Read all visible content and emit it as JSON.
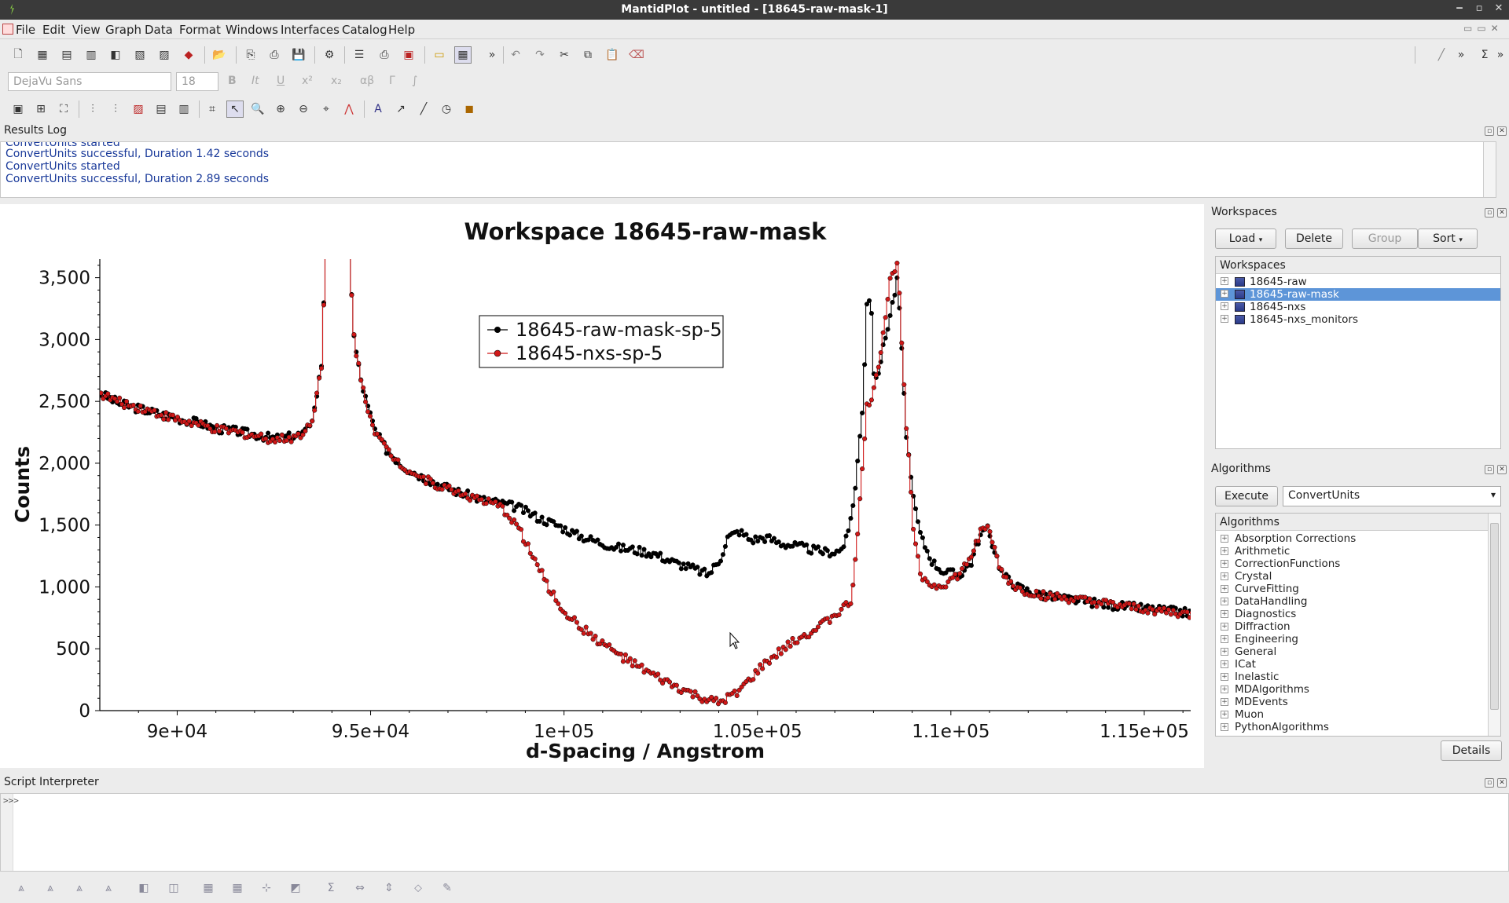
{
  "window": {
    "title": "MantidPlot - untitled - [18645-raw-mask-1]",
    "controls": [
      "‒",
      "▫",
      "✕"
    ]
  },
  "menu": [
    "File",
    "Edit",
    "View",
    "Graph",
    "Data",
    "Format",
    "Windows",
    "Interfaces",
    "Catalog",
    "Help"
  ],
  "format_bar": {
    "font": "DejaVu Sans",
    "size": "18",
    "bold": "B",
    "italic": "It",
    "underline": "U",
    "superscript": "x²",
    "subscript": "x₂",
    "greek": "αβ",
    "greek_upper": "Γ",
    "integral": "∫"
  },
  "results_log": {
    "title": "Results Log",
    "lines": [
      "ConvertUnits started",
      "ConvertUnits successful, Duration 1.42 seconds",
      "ConvertUnits started",
      "ConvertUnits successful, Duration 2.89 seconds"
    ]
  },
  "plot_tab": "1",
  "chart_data": {
    "type": "line",
    "title": "Workspace 18645-raw-mask",
    "xlabel": "d-Spacing / Angstrom",
    "ylabel": "Counts",
    "xlim": [
      88000,
      116200
    ],
    "ylim": [
      0,
      3650
    ],
    "x_ticks": [
      "9e+04",
      "9.5e+04",
      "1e+05",
      "1.05e+05",
      "1.1e+05",
      "1.15e+05"
    ],
    "x_tick_values": [
      90000,
      95000,
      100000,
      105000,
      110000,
      115000
    ],
    "y_ticks": [
      "0",
      "500",
      "1,000",
      "1,500",
      "2,000",
      "2,500",
      "3,000",
      "3,500"
    ],
    "y_tick_values": [
      0,
      500,
      1000,
      1500,
      2000,
      2500,
      3000,
      3500
    ],
    "legend_position": "top-center",
    "series": [
      {
        "name": "18645-raw-mask-sp-5",
        "color": "#000000",
        "points": [
          [
            88000,
            2560
          ],
          [
            88500,
            2480
          ],
          [
            89000,
            2440
          ],
          [
            89500,
            2400
          ],
          [
            90000,
            2360
          ],
          [
            90500,
            2330
          ],
          [
            91000,
            2280
          ],
          [
            91500,
            2260
          ],
          [
            92000,
            2230
          ],
          [
            92500,
            2200
          ],
          [
            93000,
            2220
          ],
          [
            93300,
            2250
          ],
          [
            93500,
            2400
          ],
          [
            93700,
            2800
          ],
          [
            93900,
            4500
          ],
          [
            94400,
            4500
          ],
          [
            94500,
            3100
          ],
          [
            94700,
            2700
          ],
          [
            94900,
            2450
          ],
          [
            95100,
            2250
          ],
          [
            95400,
            2100
          ],
          [
            95800,
            1980
          ],
          [
            96300,
            1890
          ],
          [
            96800,
            1820
          ],
          [
            97300,
            1760
          ],
          [
            97800,
            1710
          ],
          [
            98300,
            1680
          ],
          [
            98800,
            1640
          ],
          [
            99300,
            1560
          ],
          [
            99800,
            1500
          ],
          [
            100300,
            1420
          ],
          [
            100800,
            1370
          ],
          [
            101300,
            1320
          ],
          [
            101800,
            1300
          ],
          [
            102300,
            1270
          ],
          [
            102800,
            1200
          ],
          [
            103300,
            1150
          ],
          [
            103700,
            1100
          ],
          [
            104000,
            1220
          ],
          [
            104200,
            1400
          ],
          [
            104500,
            1450
          ],
          [
            104800,
            1380
          ],
          [
            105200,
            1400
          ],
          [
            105600,
            1350
          ],
          [
            106000,
            1330
          ],
          [
            106400,
            1300
          ],
          [
            106800,
            1280
          ],
          [
            107100,
            1290
          ],
          [
            107300,
            1400
          ],
          [
            107500,
            1800
          ],
          [
            107700,
            2500
          ],
          [
            107800,
            3300
          ],
          [
            107900,
            3360
          ],
          [
            108000,
            2600
          ],
          [
            108200,
            2900
          ],
          [
            108400,
            3200
          ],
          [
            108600,
            3500
          ],
          [
            108800,
            2300
          ],
          [
            109000,
            1700
          ],
          [
            109200,
            1400
          ],
          [
            109500,
            1200
          ],
          [
            109800,
            1120
          ],
          [
            110200,
            1100
          ],
          [
            110500,
            1200
          ],
          [
            110700,
            1400
          ],
          [
            110900,
            1480
          ],
          [
            111100,
            1300
          ],
          [
            111300,
            1100
          ],
          [
            111700,
            1000
          ],
          [
            112200,
            940
          ],
          [
            112800,
            910
          ],
          [
            113500,
            880
          ],
          [
            114200,
            850
          ],
          [
            114900,
            830
          ],
          [
            115500,
            810
          ],
          [
            116200,
            790
          ]
        ]
      },
      {
        "name": "18645-nxs-sp-5",
        "color": "#d01818",
        "points": [
          [
            88000,
            2560
          ],
          [
            88500,
            2490
          ],
          [
            89000,
            2450
          ],
          [
            89500,
            2400
          ],
          [
            90000,
            2350
          ],
          [
            90500,
            2310
          ],
          [
            91000,
            2270
          ],
          [
            91500,
            2250
          ],
          [
            92000,
            2220
          ],
          [
            92500,
            2190
          ],
          [
            93000,
            2210
          ],
          [
            93300,
            2260
          ],
          [
            93500,
            2400
          ],
          [
            93700,
            2800
          ],
          [
            93900,
            4500
          ],
          [
            94400,
            4500
          ],
          [
            94500,
            3100
          ],
          [
            94700,
            2700
          ],
          [
            94900,
            2450
          ],
          [
            95100,
            2250
          ],
          [
            95400,
            2100
          ],
          [
            95800,
            1980
          ],
          [
            96300,
            1880
          ],
          [
            96800,
            1810
          ],
          [
            97300,
            1760
          ],
          [
            97800,
            1700
          ],
          [
            98300,
            1650
          ],
          [
            98700,
            1530
          ],
          [
            99000,
            1350
          ],
          [
            99300,
            1160
          ],
          [
            99600,
            980
          ],
          [
            99900,
            830
          ],
          [
            100300,
            700
          ],
          [
            100800,
            580
          ],
          [
            101300,
            470
          ],
          [
            101800,
            370
          ],
          [
            102300,
            280
          ],
          [
            102800,
            200
          ],
          [
            103300,
            130
          ],
          [
            103700,
            80
          ],
          [
            104000,
            60
          ],
          [
            104300,
            120
          ],
          [
            104700,
            220
          ],
          [
            105100,
            360
          ],
          [
            105500,
            460
          ],
          [
            106000,
            580
          ],
          [
            106500,
            660
          ],
          [
            107000,
            780
          ],
          [
            107400,
            880
          ],
          [
            107600,
            1600
          ],
          [
            107800,
            2450
          ],
          [
            108000,
            2600
          ],
          [
            108200,
            3000
          ],
          [
            108400,
            3500
          ],
          [
            108600,
            3600
          ],
          [
            108800,
            2400
          ],
          [
            109000,
            1500
          ],
          [
            109200,
            1100
          ],
          [
            109500,
            1000
          ],
          [
            109800,
            1020
          ],
          [
            110200,
            1100
          ],
          [
            110500,
            1250
          ],
          [
            110700,
            1420
          ],
          [
            110900,
            1500
          ],
          [
            111100,
            1300
          ],
          [
            111300,
            1100
          ],
          [
            111700,
            980
          ],
          [
            112200,
            940
          ],
          [
            112800,
            910
          ],
          [
            113500,
            880
          ],
          [
            114200,
            850
          ],
          [
            114900,
            820
          ],
          [
            115500,
            800
          ],
          [
            116200,
            770
          ]
        ]
      }
    ]
  },
  "workspaces": {
    "panel_title": "Workspaces",
    "buttons": {
      "load": "Load",
      "delete": "Delete",
      "group": "Group",
      "sort": "Sort"
    },
    "tree_header": "Workspaces",
    "items": [
      "18645-raw",
      "18645-raw-mask",
      "18645-nxs",
      "18645-nxs_monitors"
    ],
    "selected": "18645-raw-mask"
  },
  "algorithms": {
    "panel_title": "Algorithms",
    "execute": "Execute",
    "search_value": "ConvertUnits",
    "tree_header": "Algorithms",
    "items": [
      "Absorption Corrections",
      "Arithmetic",
      "CorrectionFunctions",
      "Crystal",
      "CurveFitting",
      "DataHandling",
      "Diagnostics",
      "Diffraction",
      "Engineering",
      "General",
      "ICat",
      "Inelastic",
      "MDAlgorithms",
      "MDEvents",
      "Muon",
      "PythonAlgorithms"
    ],
    "details": "Details"
  },
  "script": {
    "title": "Script Interpreter",
    "prompt": ">>>"
  }
}
